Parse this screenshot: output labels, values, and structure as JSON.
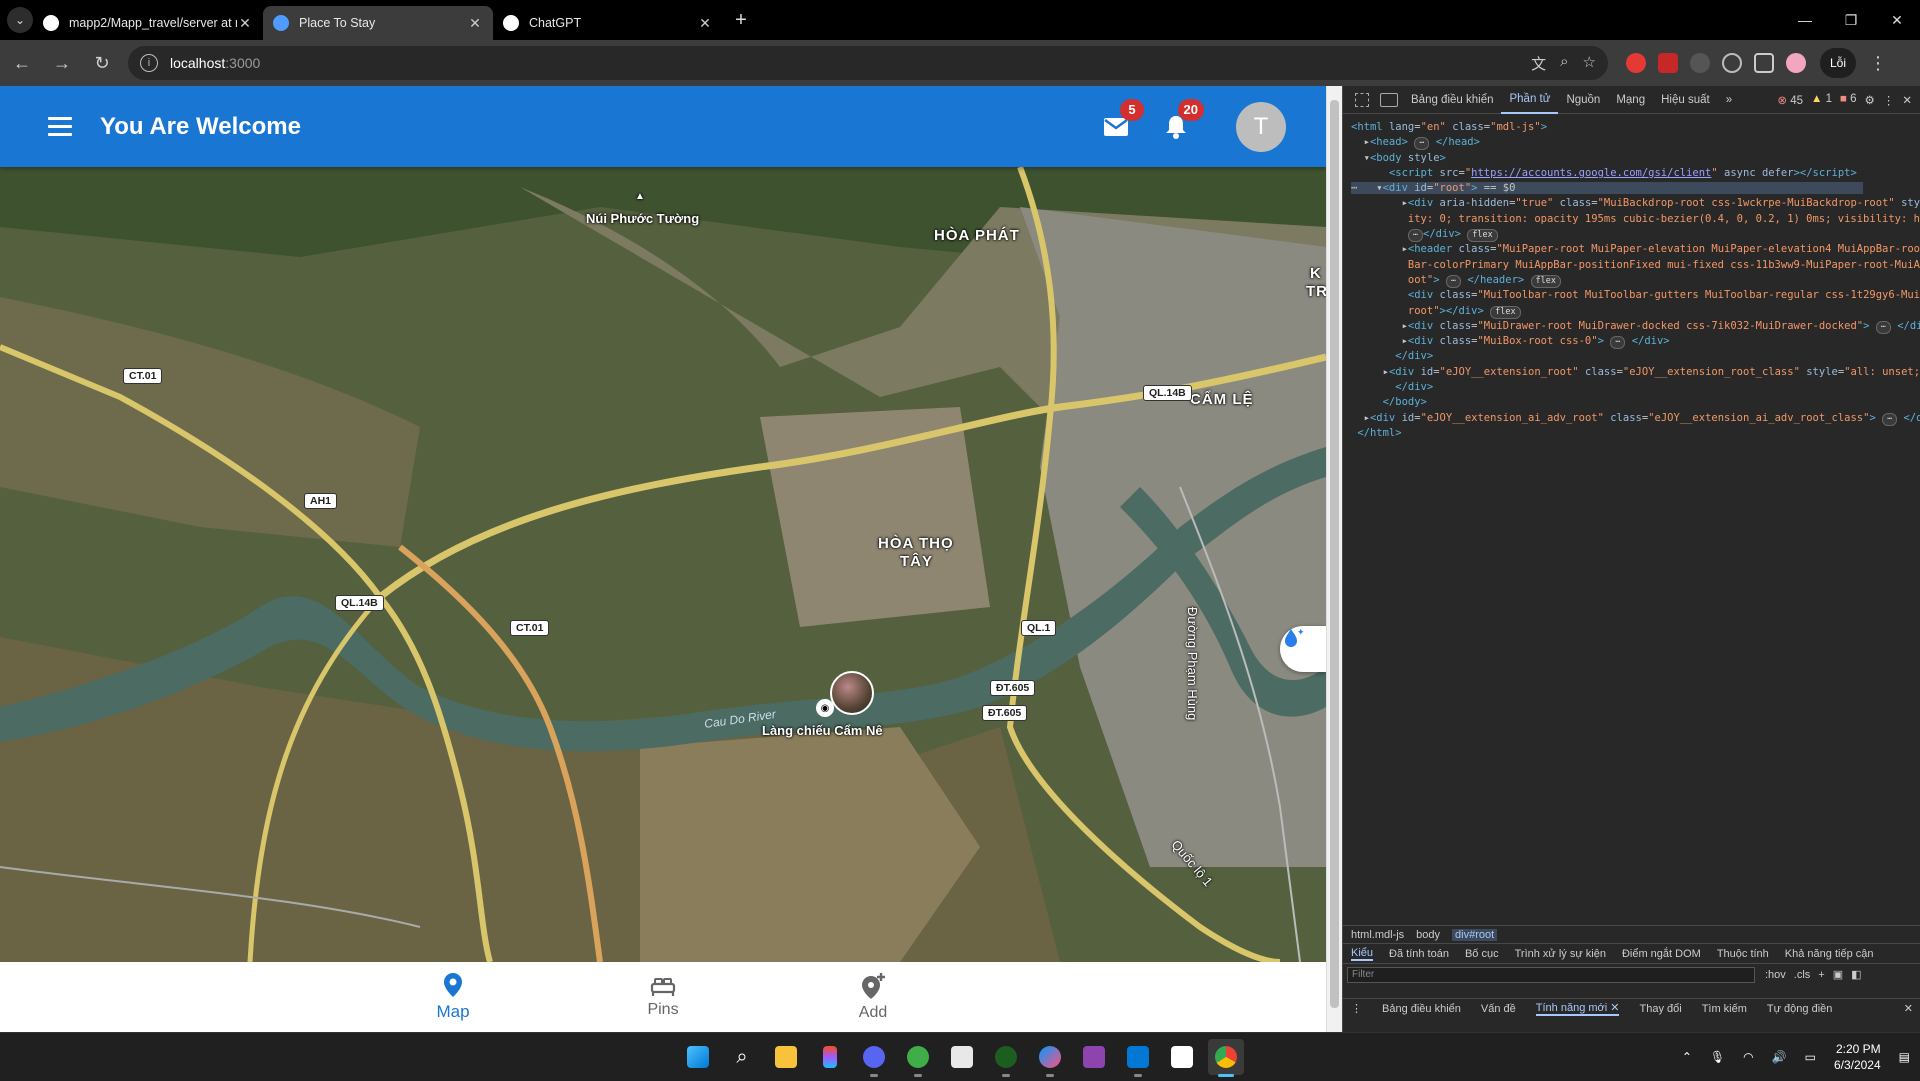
{
  "browser": {
    "tabs": [
      {
        "title": "mapp2/Mapp_travel/server at m",
        "favicon_color": "#ffffff",
        "active": false
      },
      {
        "title": "Place To Stay",
        "favicon_color": "#4f9bff",
        "active": true
      },
      {
        "title": "ChatGPT",
        "favicon_color": "#ffffff",
        "active": false
      }
    ],
    "address": {
      "host": "localhost",
      "port": ":3000"
    },
    "error_button_label": "Lỗi"
  },
  "app": {
    "title": "You Are Welcome",
    "mail_badge": "5",
    "notifications_badge": "20",
    "avatar_letter": "T",
    "accent_color": "#1976d2",
    "bottom_nav": [
      {
        "label": "Map",
        "icon": "map-pin-icon",
        "active": true
      },
      {
        "label": "Pins",
        "icon": "bed-icon",
        "active": false
      },
      {
        "label": "Add",
        "icon": "add-location-icon",
        "active": false
      }
    ]
  },
  "map": {
    "place_labels": {
      "mountain": "Núi Phước Tường",
      "hoa_phat": "HÒA PHÁT",
      "cam_le": "CẨM LỆ",
      "hoa_tho_tay_1": "HÒA THỌ",
      "hoa_tho_tay_2": "TÂY",
      "lang_chieu": "Làng chiếu Cẩm Nê",
      "street": "Đường Phạm Hùng",
      "quoc_lo": "Quốc lộ 1",
      "edge_k": "K",
      "edge_tr": "TR"
    },
    "river": "Cau Do River",
    "road_shields": {
      "ct01_a": "CT.01",
      "ah1": "AH1",
      "ql14b_a": "QL.14B",
      "ct01_b": "CT.01",
      "ql14b_b": "QL.14B",
      "ql1": "QL.1",
      "dt605_a": "ĐT.605",
      "dt605_b": "ĐT.605"
    }
  },
  "devtools": {
    "tabs": [
      "Bảng điều khiển",
      "Phần tử",
      "Nguồn",
      "Mạng",
      "Hiệu suất"
    ],
    "counts": {
      "errors": "45",
      "warnings": "1",
      "issues": "6"
    },
    "breadcrumb": [
      "html.mdl-js",
      "body",
      "div#root"
    ],
    "style_tabs": [
      "Kiểu",
      "Đã tính toán",
      "Bố cục",
      "Trình xử lý sự kiện",
      "Điểm ngắt DOM",
      "Thuộc tính",
      "Khả năng tiếp cận"
    ],
    "filter_placeholder": "Filter",
    "filter_hov": ":hov",
    "filter_cls": ".cls",
    "drawer_tabs": [
      "Bảng điều khiển",
      "Vấn đề",
      "Tính năng mới",
      "Thay đổi",
      "Tìm kiếm",
      "Tự động điền"
    ]
  },
  "taskbar": {
    "time": "2:20 PM",
    "date": "6/3/2024"
  }
}
